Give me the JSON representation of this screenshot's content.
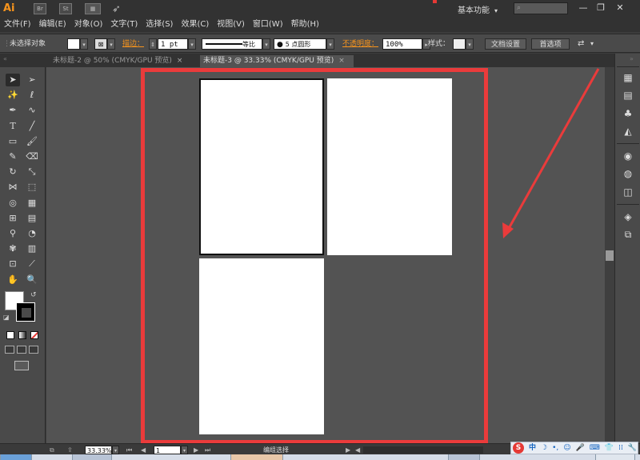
{
  "app": {
    "logo": "Ai",
    "toolbar_icons": [
      "Br",
      "St",
      "layout-icon",
      "rocket-icon"
    ],
    "workspace_label": "基本功能",
    "search_placeholder": "",
    "window_buttons": [
      "—",
      "❐",
      "✕"
    ]
  },
  "menu": [
    "文件(F)",
    "编辑(E)",
    "对象(O)",
    "文字(T)",
    "选择(S)",
    "效果(C)",
    "视图(V)",
    "窗口(W)",
    "帮助(H)"
  ],
  "control_bar": {
    "selection_label": "未选择对象",
    "stroke_label": "描边：",
    "stroke_value": "1 pt",
    "profile_label": "等比",
    "brush_label": "5 点圆形",
    "opacity_label": "不透明度：",
    "opacity_value": "100%",
    "style_label": "样式：",
    "doc_setup_button": "文档设置",
    "prefs_button": "首选项"
  },
  "tabs": [
    {
      "label": "未标题-2 @ 50% (CMYK/GPU 预览)",
      "active": false
    },
    {
      "label": "未标题-3 @ 33.33% (CMYK/GPU 预览)",
      "active": true
    }
  ],
  "tools": [
    "selection-tool-icon",
    "direct-selection-tool-icon",
    "magic-wand-tool-icon",
    "lasso-tool-icon",
    "pen-tool-icon",
    "curvature-tool-icon",
    "type-tool-icon",
    "line-tool-icon",
    "rectangle-tool-icon",
    "paintbrush-tool-icon",
    "pencil-tool-icon",
    "eraser-tool-icon",
    "rotate-tool-icon",
    "scale-tool-icon",
    "width-tool-icon",
    "free-transform-tool-icon",
    "shape-builder-tool-icon",
    "perspective-grid-tool-icon",
    "mesh-tool-icon",
    "gradient-tool-icon",
    "eyedropper-tool-icon",
    "blend-tool-icon",
    "symbol-sprayer-tool-icon",
    "column-graph-tool-icon",
    "artboard-tool-icon",
    "slice-tool-icon",
    "hand-tool-icon",
    "zoom-tool-icon"
  ],
  "dock_icons": [
    "color-guide-icon",
    "swatches-icon",
    "brushes-icon",
    "symbols-icon",
    "appearance-icon",
    "graphic-styles-icon",
    "transparency-icon",
    "layers-icon",
    "artboards-icon"
  ],
  "status_bar": {
    "zoom": "33.33%",
    "artboard_number": "1",
    "mode_label": "编组选择"
  },
  "ime": {
    "logo": "S",
    "language": "中"
  },
  "colors": {
    "annotation_red": "#ea3b3b",
    "accent_orange": "#f7941d",
    "canvas_gray": "#535353",
    "panel_gray": "#4a4a4a"
  }
}
